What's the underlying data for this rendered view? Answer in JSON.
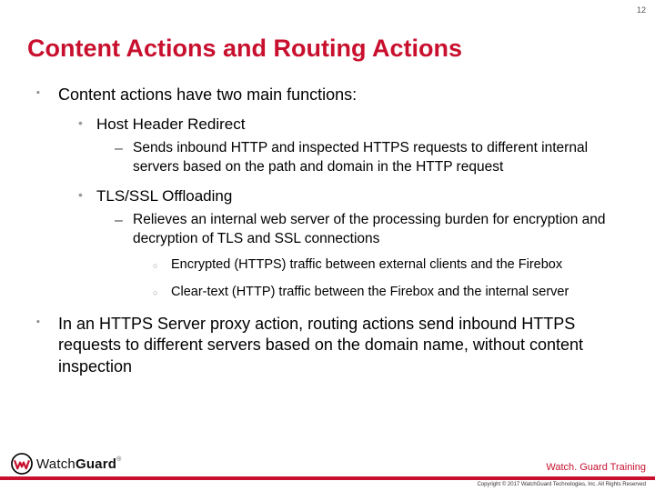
{
  "page_number": "12",
  "title": "Content Actions and Routing Actions",
  "bullets": {
    "b1": "Content actions have two main functions:",
    "b1_1": "Host Header Redirect",
    "b1_1_1": "Sends inbound HTTP and inspected HTTPS requests to different internal servers based on the path and domain in the HTTP request",
    "b1_2": "TLS/SSL Offloading",
    "b1_2_1": "Relieves an internal web server of the processing burden for encryption and decryption of TLS and SSL connections",
    "b1_2_1_a": "Encrypted (HTTPS) traffic between external clients and the Firebox",
    "b1_2_1_b": "Clear-text (HTTP) traffic between the Firebox and the internal server",
    "b2": "In an HTTPS Server proxy action, routing actions send inbound HTTPS requests to different servers based on the domain name, without content inspection"
  },
  "footer": {
    "brand_first": "Watch",
    "brand_second": "Guard",
    "training": "Watch. Guard Training",
    "copyright": "Copyright © 2017 WatchGuard Technologies, Inc. All Rights Reserved"
  },
  "colors": {
    "accent": "#c8102e"
  }
}
